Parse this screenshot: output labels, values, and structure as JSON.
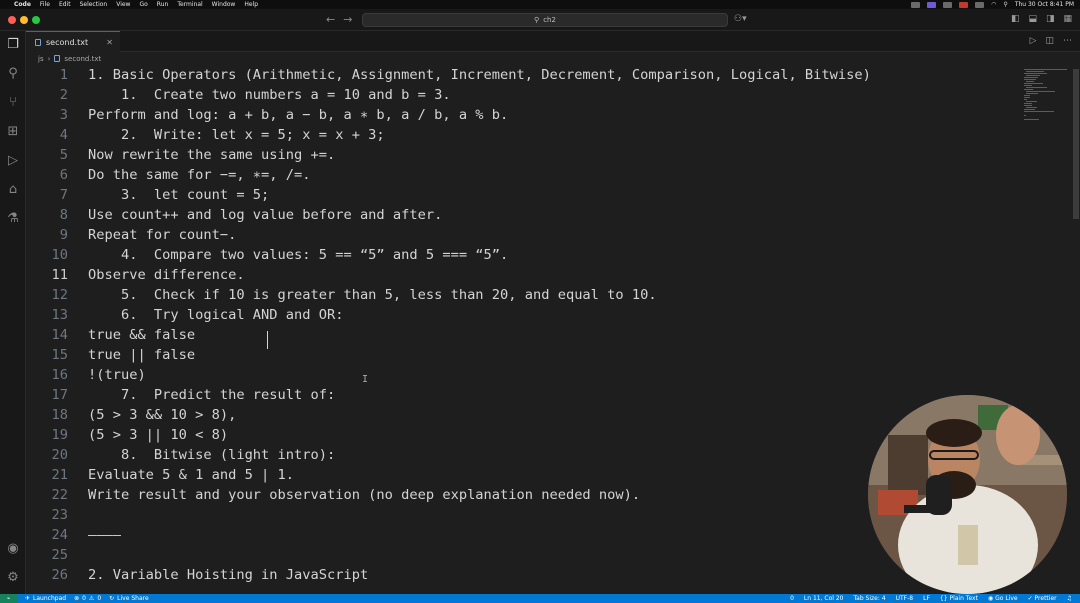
{
  "menubar": {
    "app": "Code",
    "items": [
      "File",
      "Edit",
      "Selection",
      "View",
      "Go",
      "Run",
      "Terminal",
      "Window",
      "Help"
    ],
    "clock": "Thu 30 Oct  8:41 PM"
  },
  "titlebar": {
    "search": "ch2"
  },
  "tab": {
    "filename": "second.txt"
  },
  "breadcrumb": {
    "folder": "js",
    "file": "second.txt"
  },
  "editor": {
    "lines": [
      {
        "num": "1",
        "text": "1. Basic Operators (Arithmetic, Assignment, Increment, Decrement, Comparison, Logical, Bitwise)"
      },
      {
        "num": "2",
        "text": "    1.  Create two numbers a = 10 and b = 3."
      },
      {
        "num": "3",
        "text": "Perform and log: a + b, a − b, a ∗ b, a / b, a % b."
      },
      {
        "num": "4",
        "text": "    2.  Write: let x = 5; x = x + 3;"
      },
      {
        "num": "5",
        "text": "Now rewrite the same using +=."
      },
      {
        "num": "6",
        "text": "Do the same for −=, ∗=, /=."
      },
      {
        "num": "7",
        "text": "    3.  let count = 5;"
      },
      {
        "num": "8",
        "text": "Use count++ and log value before and after."
      },
      {
        "num": "9",
        "text": "Repeat for count−."
      },
      {
        "num": "10",
        "text": "    4.  Compare two values: 5 == “5” and 5 === “5”."
      },
      {
        "num": "11",
        "text": "Observe difference."
      },
      {
        "num": "12",
        "text": "    5.  Check if 10 is greater than 5, less than 20, and equal to 10."
      },
      {
        "num": "13",
        "text": "    6.  Try logical AND and OR:"
      },
      {
        "num": "14",
        "text": "true && false"
      },
      {
        "num": "15",
        "text": "true || false"
      },
      {
        "num": "16",
        "text": "!(true)"
      },
      {
        "num": "17",
        "text": "    7.  Predict the result of:"
      },
      {
        "num": "18",
        "text": "(5 > 3 && 10 > 8),"
      },
      {
        "num": "19",
        "text": "(5 > 3 || 10 < 8)"
      },
      {
        "num": "20",
        "text": "    8.  Bitwise (light intro):"
      },
      {
        "num": "21",
        "text": "Evaluate 5 & 1 and 5 | 1."
      },
      {
        "num": "22",
        "text": "Write result and your observation (no deep explanation needed now)."
      },
      {
        "num": "23",
        "text": ""
      },
      {
        "num": "24",
        "text": "————"
      },
      {
        "num": "25",
        "text": ""
      },
      {
        "num": "26",
        "text": "2. Variable Hoisting in JavaScript"
      }
    ],
    "current_line": 11
  },
  "statusbar": {
    "launchpad": "Launchpad",
    "errors": "0",
    "warnings": "0",
    "live_share": "Live Share",
    "ports": "0",
    "position": "Ln 11, Col 20",
    "tab_size": "Tab Size: 4",
    "encoding": "UTF-8",
    "eol": "LF",
    "language": "Plain Text",
    "go_live": "Go Live",
    "prettier": "Prettier"
  },
  "colors": {
    "editor_bg": "#1e1e1e",
    "accent": "#0078d4",
    "text": "#d4d4d4",
    "line_number": "#6e7681"
  }
}
